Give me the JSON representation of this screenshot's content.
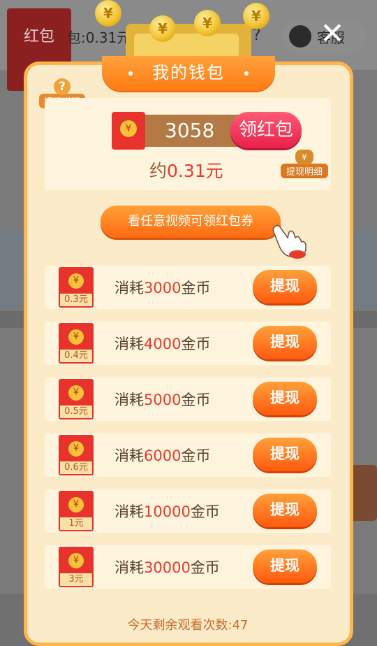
{
  "background": {
    "red_packet_label": "红包",
    "balance_text": "包:0.31元",
    "question_mark": "?",
    "service_label": "客服"
  },
  "close": {
    "symbol": "✕"
  },
  "modal": {
    "title": "我的钱包",
    "help_label": "提现说明",
    "help_symbol": "?",
    "coin_count": "3058",
    "claim_label": "领红包",
    "approx_prefix": "约",
    "approx_value": "0.31元",
    "detail_label": "提现明细",
    "video_button": "看任意视频可领红包券",
    "withdraw_rows": [
      {
        "amount": "0.3元",
        "prefix": "消耗",
        "coins": "3000",
        "suffix": "金币",
        "button": "提现"
      },
      {
        "amount": "0.4元",
        "prefix": "消耗",
        "coins": "4000",
        "suffix": "金币",
        "button": "提现"
      },
      {
        "amount": "0.5元",
        "prefix": "消耗",
        "coins": "5000",
        "suffix": "金币",
        "button": "提现"
      },
      {
        "amount": "0.6元",
        "prefix": "消耗",
        "coins": "6000",
        "suffix": "金币",
        "button": "提现"
      },
      {
        "amount": "1元",
        "prefix": "消耗",
        "coins": "10000",
        "suffix": "金币",
        "button": "提现"
      },
      {
        "amount": "3元",
        "prefix": "消耗",
        "coins": "30000",
        "suffix": "金币",
        "button": "提现"
      }
    ],
    "remaining_text": "今天剩余观看次数:47"
  },
  "colors": {
    "accent": "#ff7a14",
    "highlight": "#e83a2a",
    "panel": "#fff4de",
    "border": "#ffb54a"
  },
  "icons": [
    "close-icon",
    "yuan-coin-icon",
    "question-icon",
    "money-bag-icon",
    "hand-pointer-icon",
    "red-envelope-icon"
  ]
}
